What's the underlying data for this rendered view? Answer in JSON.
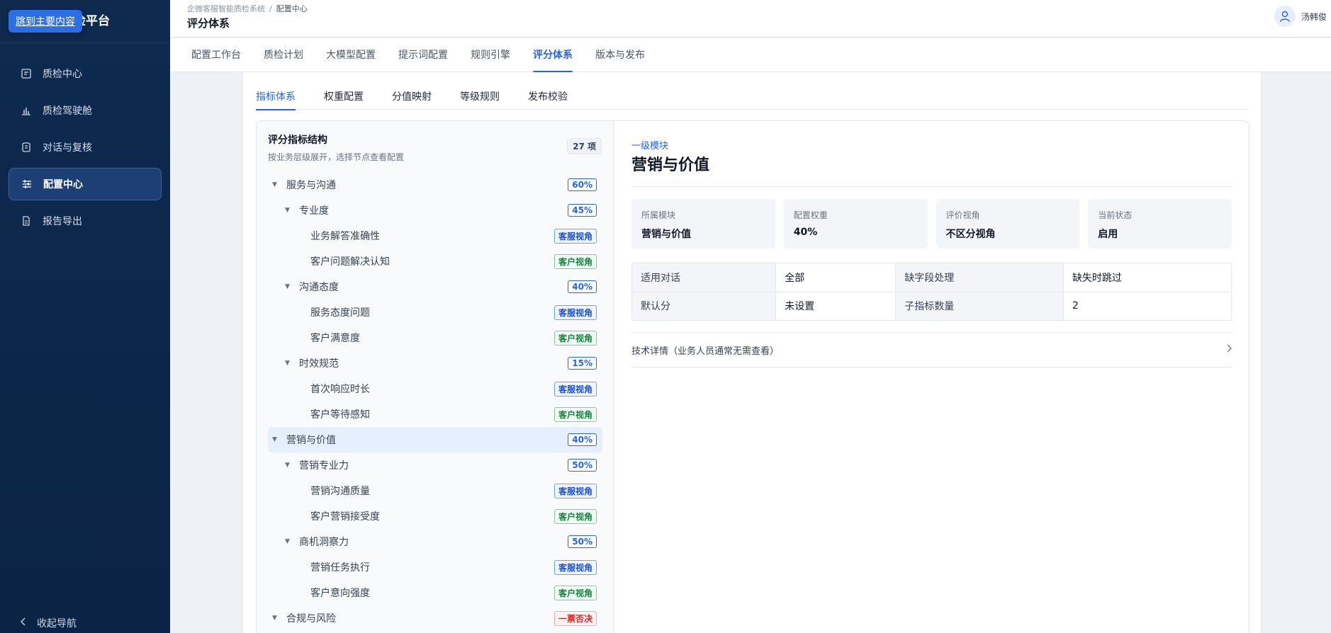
{
  "sidebar": {
    "skip_link": "跳到主要内容",
    "brand_suffix": "检平台",
    "items": [
      {
        "label": "质检中心",
        "icon": "clipboard-icon"
      },
      {
        "label": "质检驾驶舱",
        "icon": "bar-chart-icon"
      },
      {
        "label": "对话与复核",
        "icon": "conversation-icon"
      },
      {
        "label": "配置中心",
        "icon": "sliders-icon",
        "active": true
      },
      {
        "label": "报告导出",
        "icon": "document-icon"
      }
    ],
    "collapse_label": "收起导航"
  },
  "header": {
    "breadcrumb": [
      "企微客服智能质检系统",
      "配置中心"
    ],
    "breadcrumb_sep": "/",
    "title": "评分体系",
    "user_name": "汤韩俊"
  },
  "tabs": [
    "配置工作台",
    "质检计划",
    "大模型配置",
    "提示词配置",
    "规则引擎",
    "评分体系",
    "版本与发布"
  ],
  "active_tab": "评分体系",
  "subtabs": [
    "指标体系",
    "权重配置",
    "分值映射",
    "等级规则",
    "发布校验"
  ],
  "active_subtab": "指标体系",
  "tree": {
    "title": "评分指标结构",
    "subtitle": "按业务层级展开，选择节点查看配置",
    "count": "27 项",
    "rows": [
      {
        "label": "服务与沟通",
        "level": 0,
        "tag": "60%",
        "tag_type": "pct",
        "caret": true
      },
      {
        "label": "专业度",
        "level": 1,
        "tag": "45%",
        "tag_type": "pct",
        "caret": true
      },
      {
        "label": "业务解答准确性",
        "level": 2,
        "tag": "客服视角",
        "tag_type": "blue"
      },
      {
        "label": "客户问题解决认知",
        "level": 2,
        "tag": "客户视角",
        "tag_type": "green"
      },
      {
        "label": "沟通态度",
        "level": 1,
        "tag": "40%",
        "tag_type": "pct",
        "caret": true
      },
      {
        "label": "服务态度问题",
        "level": 2,
        "tag": "客服视角",
        "tag_type": "blue"
      },
      {
        "label": "客户满意度",
        "level": 2,
        "tag": "客户视角",
        "tag_type": "green"
      },
      {
        "label": "时效规范",
        "level": 1,
        "tag": "15%",
        "tag_type": "pct",
        "caret": true
      },
      {
        "label": "首次响应时长",
        "level": 2,
        "tag": "客服视角",
        "tag_type": "blue"
      },
      {
        "label": "客户等待感知",
        "level": 2,
        "tag": "客户视角",
        "tag_type": "green"
      },
      {
        "label": "营销与价值",
        "level": 0,
        "tag": "40%",
        "tag_type": "pct",
        "caret": true,
        "selected": true
      },
      {
        "label": "营销专业力",
        "level": 1,
        "tag": "50%",
        "tag_type": "pct",
        "caret": true
      },
      {
        "label": "营销沟通质量",
        "level": 2,
        "tag": "客服视角",
        "tag_type": "blue"
      },
      {
        "label": "客户营销接受度",
        "level": 2,
        "tag": "客户视角",
        "tag_type": "green"
      },
      {
        "label": "商机洞察力",
        "level": 1,
        "tag": "50%",
        "tag_type": "pct",
        "caret": true
      },
      {
        "label": "营销任务执行",
        "level": 2,
        "tag": "客服视角",
        "tag_type": "blue"
      },
      {
        "label": "客户意向强度",
        "level": 2,
        "tag": "客户视角",
        "tag_type": "green"
      },
      {
        "label": "合规与风险",
        "level": 0,
        "tag": "一票否决",
        "tag_type": "red",
        "caret": true
      }
    ]
  },
  "detail": {
    "module_label": "一级模块",
    "title": "营销与价值",
    "stats": [
      {
        "k": "所属模块",
        "v": "营销与价值"
      },
      {
        "k": "配置权重",
        "v": "40%"
      },
      {
        "k": "评价视角",
        "v": "不区分视角"
      },
      {
        "k": "当前状态",
        "v": "启用"
      }
    ],
    "table": [
      [
        "适用对话",
        "全部",
        "缺字段处理",
        "缺失时跳过"
      ],
      [
        "默认分",
        "未设置",
        "子指标数量",
        "2"
      ]
    ],
    "tech_label": "技术详情（业务人员通常无需查看）"
  }
}
